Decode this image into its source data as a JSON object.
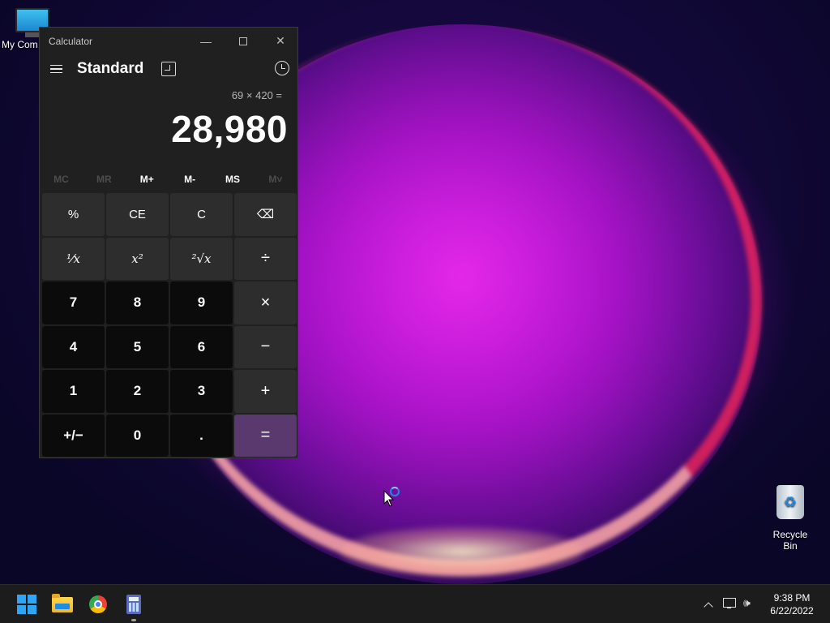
{
  "desktop": {
    "icons": {
      "my_computer": "My Com",
      "recycle_bin": "Recycle Bin"
    }
  },
  "window": {
    "title": "Calculator",
    "mode": "Standard",
    "expression": "69 × 420 =",
    "result": "28,980",
    "memory": {
      "mc": "MC",
      "mr": "MR",
      "m_plus": "M+",
      "m_minus": "M-",
      "ms": "MS",
      "m_list": "M˅"
    },
    "keys": {
      "percent": "%",
      "ce": "CE",
      "c": "C",
      "backspace": "⌫",
      "reciprocal": "⅟x",
      "square": "x²",
      "sqrt": "²√x",
      "divide": "÷",
      "seven": "7",
      "eight": "8",
      "nine": "9",
      "multiply": "×",
      "four": "4",
      "five": "5",
      "six": "6",
      "minus": "−",
      "one": "1",
      "two": "2",
      "three": "3",
      "plus": "+",
      "negate": "+/−",
      "zero": "0",
      "decimal": ".",
      "equals": "="
    }
  },
  "taskbar": {
    "apps": [
      "start-icon",
      "file-explorer-icon",
      "chrome-icon",
      "calculator-icon"
    ],
    "clock_time": "9:38 PM",
    "clock_date": "6/22/2022"
  },
  "colors": {
    "equals_accent": "#5a3a6e",
    "start_blue": "#2fa6f5"
  }
}
